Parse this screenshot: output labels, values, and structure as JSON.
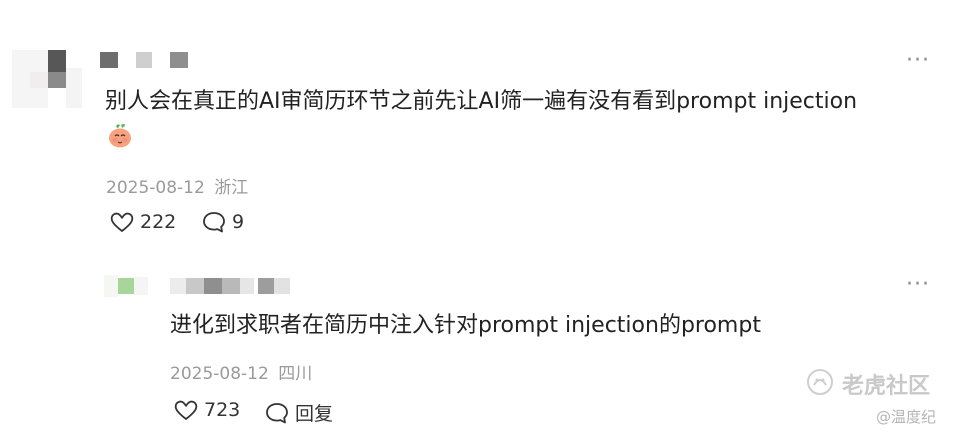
{
  "comment": {
    "text": "别人会在真正的AI审简历环节之前先让AI筛一遍有没有看到prompt injection",
    "emoji": "peach-face-emoji",
    "date": "2025-08-12",
    "location": "浙江",
    "likes": "222",
    "replies": "9",
    "more_label": "···"
  },
  "reply": {
    "text": "进化到求职者在简历中注入针对prompt injection的prompt",
    "date": "2025-08-12",
    "location": "四川",
    "likes": "723",
    "reply_label": "回复",
    "more_label": "···"
  },
  "watermark": {
    "main": "老虎社区",
    "sub": "@温度纪"
  }
}
